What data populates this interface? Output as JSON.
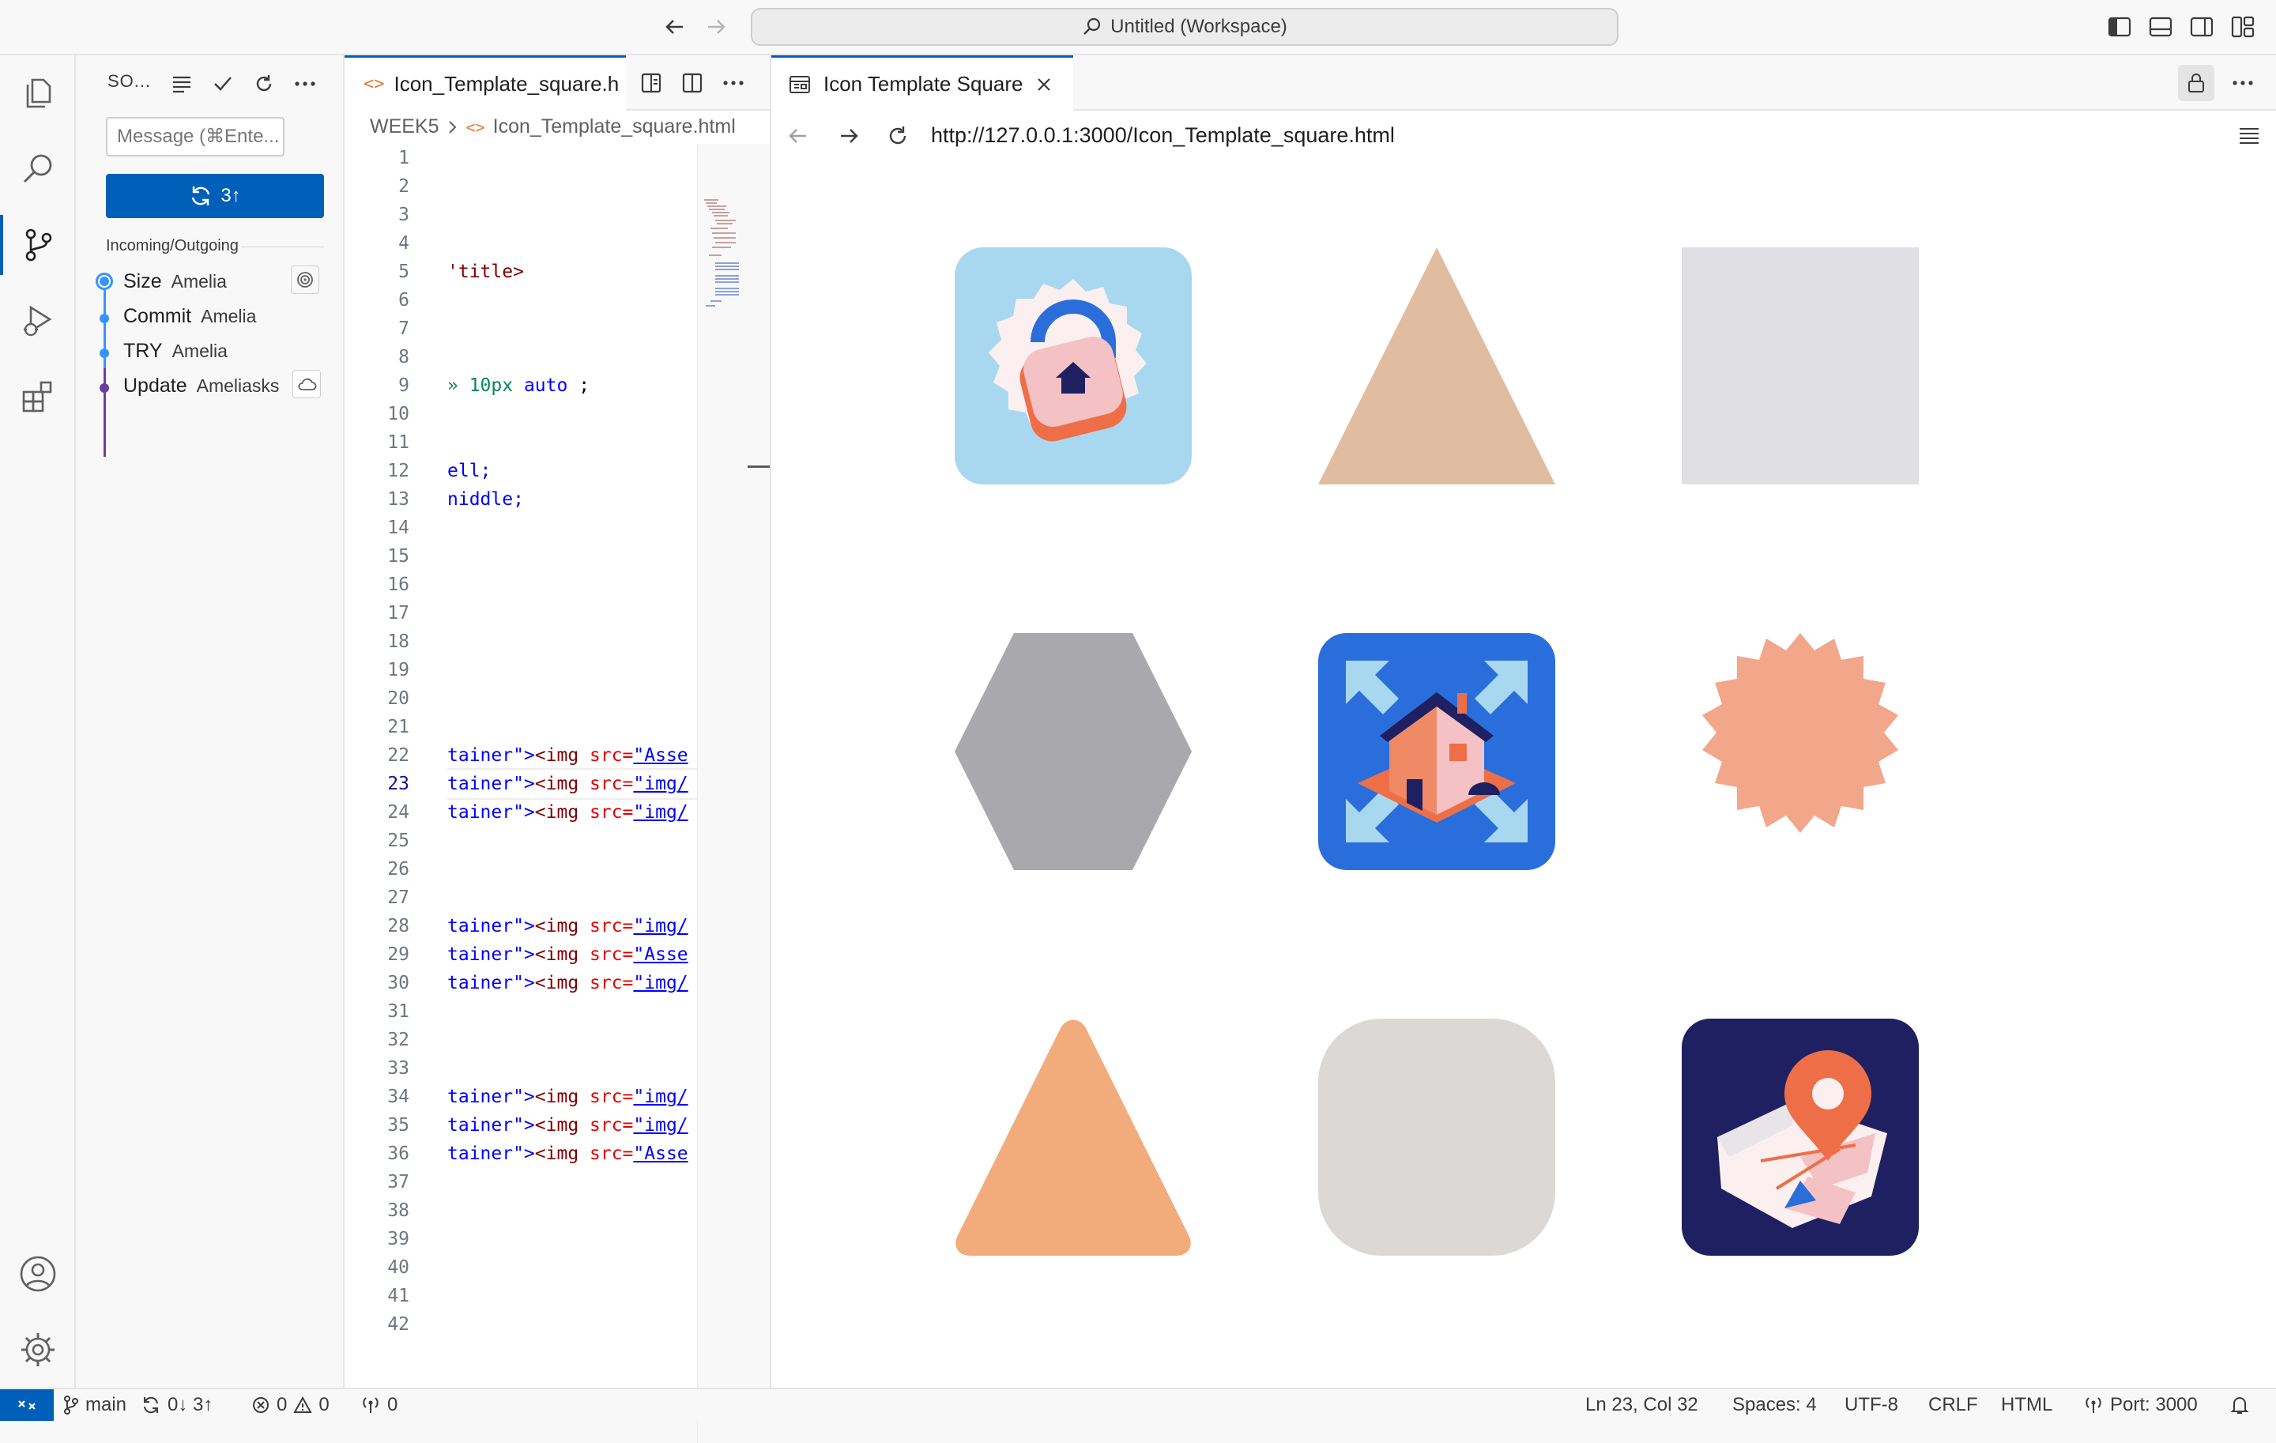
{
  "titlebar": {
    "workspace_title": "Untitled (Workspace)"
  },
  "activity_bar": {
    "items": [
      "explorer",
      "search",
      "source-control",
      "run-and-debug",
      "extensions"
    ],
    "bottom": [
      "accounts",
      "manage"
    ]
  },
  "scm": {
    "title": "SO...",
    "message_placeholder": "Message (⌘Ente...",
    "sync_button_label": "3↑",
    "section_label": "Incoming/Outgoing",
    "commits": [
      {
        "message": "Size",
        "author": "Amelia"
      },
      {
        "message": "Commit",
        "author": "Amelia"
      },
      {
        "message": "TRY",
        "author": "Amelia"
      },
      {
        "message": "Update",
        "author": "Ameliasks"
      }
    ]
  },
  "editor": {
    "tab_label": "Icon_Template_square.h",
    "breadcrumb": [
      "WEEK5",
      "Icon_Template_square.html"
    ],
    "line_numbers": [
      "1",
      "2",
      "3",
      "4",
      "5",
      "6",
      "7",
      "8",
      "9",
      "10",
      "11",
      "12",
      "13",
      "14",
      "15",
      "16",
      "17",
      "18",
      "19",
      "20",
      "21",
      "22",
      "23",
      "24",
      "25",
      "26",
      "27",
      "28",
      "29",
      "30",
      "31",
      "32",
      "33",
      "34",
      "35",
      "36",
      "37",
      "38",
      "39",
      "40",
      "41",
      "42"
    ],
    "current_line": "23",
    "code_lines": {
      "l5": "'title>",
      "l9a": "» ",
      "l9b": "10px",
      "l9c": " auto",
      "l9d": " ;",
      "l12": "ell;",
      "l13": "niddle;",
      "frag_tainer": "tainer\">",
      "frag_img": "<img",
      "frag_src": " src=",
      "frag_asse": "\"Asse",
      "frag_imgpath": "\"img/"
    }
  },
  "preview": {
    "tab_label": "Icon Template Square",
    "url": "http://127.0.0.1:3000/Icon_Template_square.html",
    "grid": [
      {
        "name": "lock-app-icon",
        "color": "#a8d8f0"
      },
      {
        "name": "triangle-shape",
        "color": "#e0bca0"
      },
      {
        "name": "square-shape",
        "color": "#e0dfe3"
      },
      {
        "name": "hexagon-shape",
        "color": "#a9a8ac"
      },
      {
        "name": "house-app-icon",
        "color": "#2a6edb"
      },
      {
        "name": "starburst-shape",
        "color": "#f2a78a"
      },
      {
        "name": "rounded-triangle-shape",
        "color": "#f2ac7c"
      },
      {
        "name": "rounded-square-shape",
        "color": "#dcd8d5"
      },
      {
        "name": "map-pin-app-icon",
        "color": "#1e2061"
      }
    ]
  },
  "statusbar": {
    "branch": "main",
    "sync": "0↓ 3↑",
    "errors": "0",
    "warnings": "0",
    "ports": "0",
    "cursor": "Ln 23, Col 32",
    "spaces": "Spaces: 4",
    "encoding": "UTF-8",
    "eol": "CRLF",
    "language": "HTML",
    "port": "Port: 3000"
  },
  "colors": {
    "accent": "#005fb8",
    "graph_blue": "#3794ff",
    "graph_purple": "#6b3fa0"
  }
}
